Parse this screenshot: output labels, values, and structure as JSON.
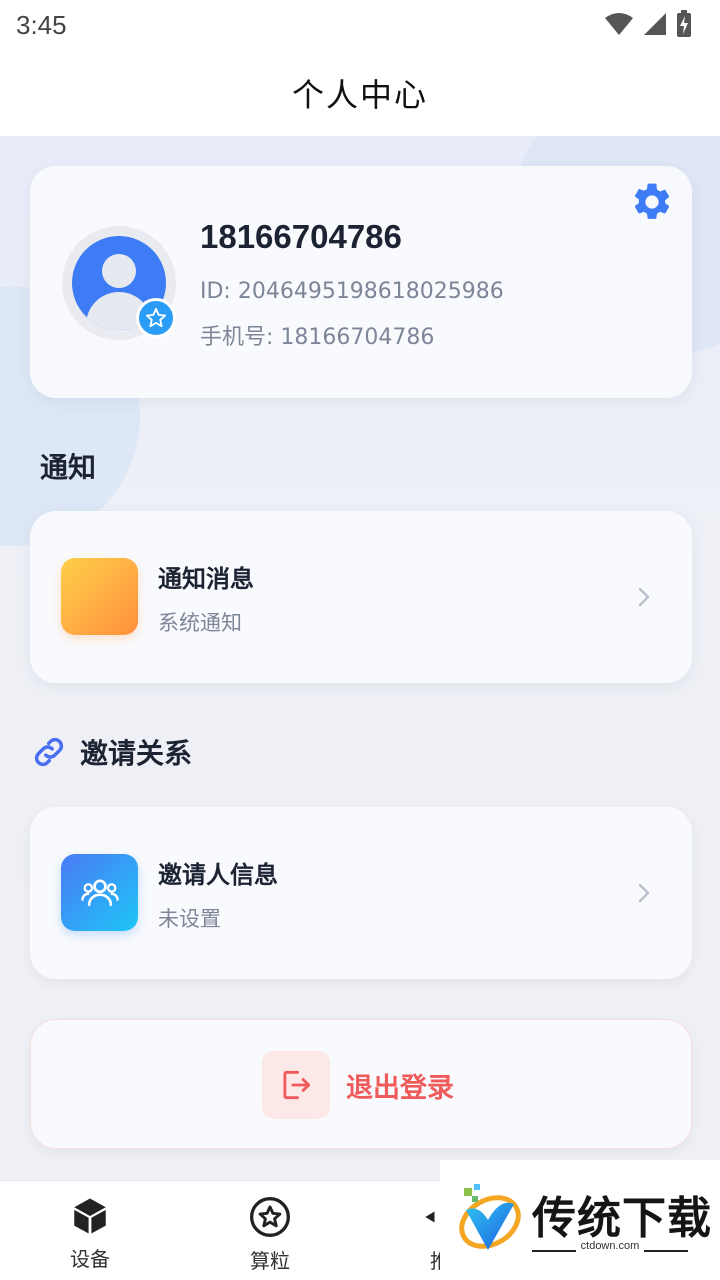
{
  "status_bar": {
    "time": "3:45"
  },
  "header": {
    "title": "个人中心"
  },
  "profile": {
    "name": "18166704786",
    "id_text": "ID: 2046495198618025986",
    "phone_text": "手机号: 18166704786"
  },
  "notify_section": {
    "title": "通知",
    "item": {
      "title": "通知消息",
      "subtitle": "系统通知"
    }
  },
  "invite_section": {
    "title": "邀请关系",
    "item": {
      "title": "邀请人信息",
      "subtitle": "未设置"
    }
  },
  "logout": {
    "label": "退出登录"
  },
  "bottom_nav": {
    "items": [
      {
        "label": "设备",
        "icon": "cube-icon"
      },
      {
        "label": "算粒",
        "icon": "star-circle-icon"
      },
      {
        "label": "推",
        "icon": "share-icon"
      }
    ]
  },
  "watermark": {
    "brand": "传统下载",
    "url": "ctdown.com"
  },
  "colors": {
    "accent_blue": "#3d7cf5",
    "logout_red": "#ef5b5b",
    "orange_tile": "#ff8e3c",
    "blue_tile": "#1ec6f6"
  }
}
